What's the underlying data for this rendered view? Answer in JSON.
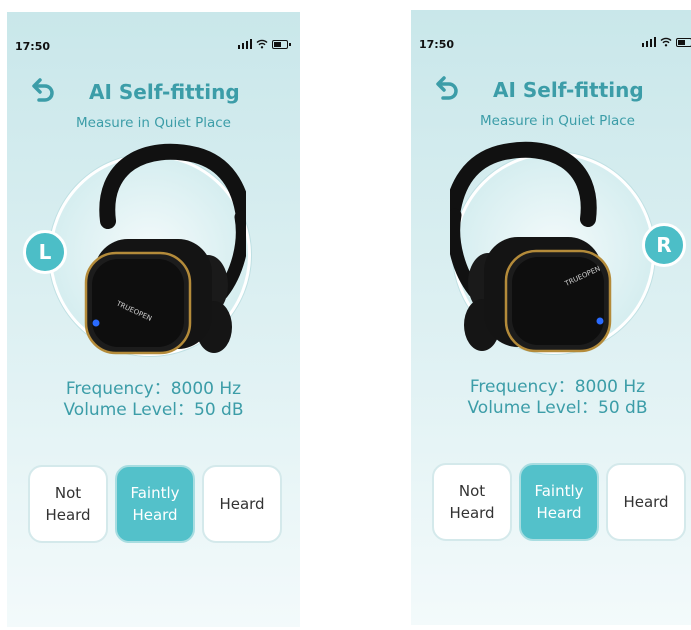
{
  "screens": [
    {
      "status": {
        "time": "17:50"
      },
      "header": {
        "title": "AI Self-fitting",
        "subtitle": "Measure in Quiet Place"
      },
      "side_label": "L",
      "earbud_brand": "TRUEOPEN",
      "info": {
        "frequency": "Frequency：8000 Hz",
        "volume": "Volume Level：50 dB"
      },
      "responses": [
        {
          "label": "Not Heard",
          "selected": false
        },
        {
          "label": "Faintly Heard",
          "selected": true
        },
        {
          "label": "Heard",
          "selected": false
        }
      ]
    },
    {
      "status": {
        "time": "17:50"
      },
      "header": {
        "title": "AI Self-fitting",
        "subtitle": "Measure in Quiet Place"
      },
      "side_label": "R",
      "earbud_brand": "TRUEOPEN",
      "info": {
        "frequency": "Frequency：8000 Hz",
        "volume": "Volume Level：50 dB"
      },
      "responses": [
        {
          "label": "Not Heard",
          "selected": false
        },
        {
          "label": "Faintly Heard",
          "selected": true
        },
        {
          "label": "Heard",
          "selected": false
        }
      ]
    }
  ],
  "colors": {
    "accent": "#3c9da8",
    "selected_button": "#53c1ca",
    "badge": "#4cbec7"
  }
}
